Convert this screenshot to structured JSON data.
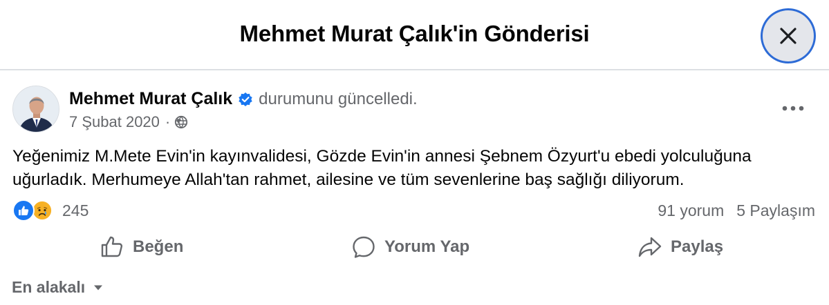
{
  "header": {
    "title": "Mehmet Murat Çalık'in Gönderisi",
    "close_icon": "close-icon"
  },
  "post": {
    "author": "Mehmet Murat Çalık",
    "verified_icon": "verified-badge-icon",
    "action": "durumunu güncelledi.",
    "date": "7 Şubat 2020",
    "separator": "·",
    "privacy_icon": "globe-icon",
    "more_icon": "more-options-icon",
    "text": "Yeğenimiz M.Mete Evin'in kayınvalidesi, Gözde Evin'in annesi Şebnem Özyurt'u ebedi yolculuğuna uğurladık. Merhumeye Allah'tan rahmet, ailesine ve tüm sevenlerine baş sağlığı diliyorum."
  },
  "stats": {
    "reaction_icons": [
      "like-icon",
      "sad-icon"
    ],
    "reaction_count": "245",
    "comments": "91 yorum",
    "shares": "5 Paylaşım"
  },
  "actions": {
    "like": "Beğen",
    "comment": "Yorum Yap",
    "share": "Paylaş"
  },
  "comments_sort": {
    "label": "En alakalı",
    "icon": "caret-down-icon"
  },
  "colors": {
    "text": "#050505",
    "secondary": "#65676b",
    "brand_blue": "#1877f2",
    "close_bg": "#e4e6eb",
    "focus_ring": "#2d6bd6",
    "divider": "#dcdfe3"
  }
}
